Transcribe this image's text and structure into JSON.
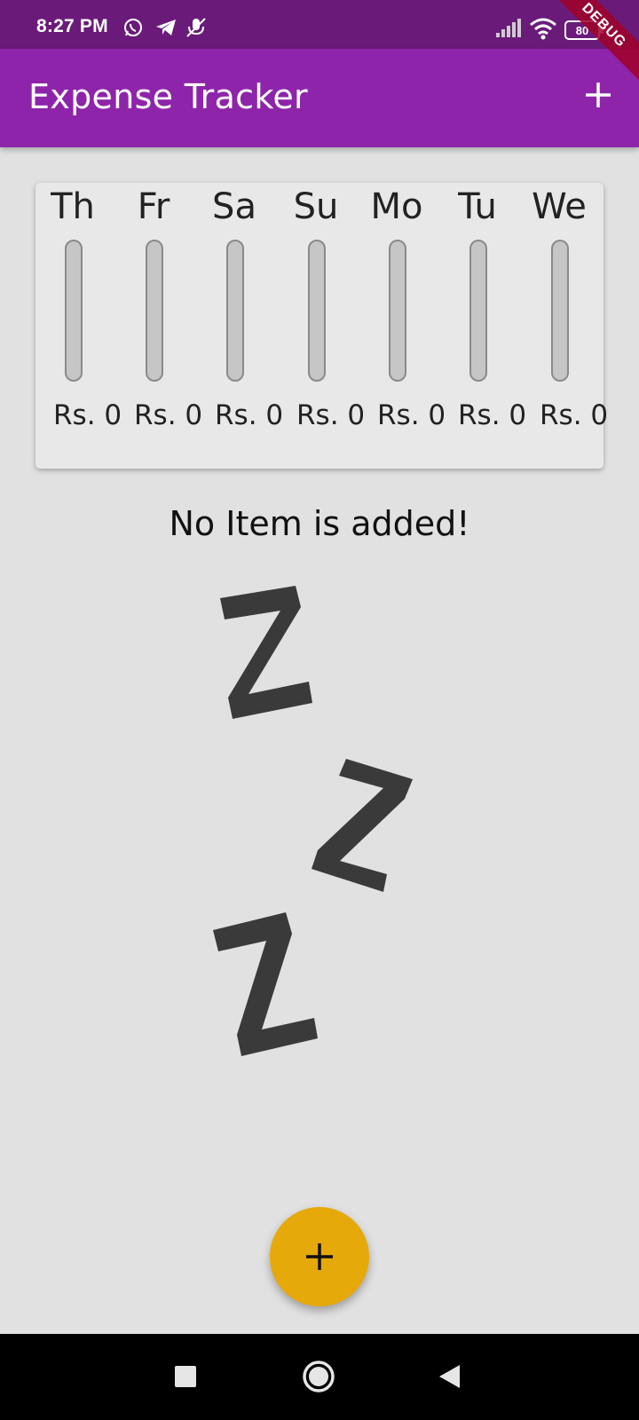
{
  "status_bar": {
    "time": "8:27 PM",
    "battery": "80",
    "icons": [
      "whatsapp-icon",
      "telegram-icon",
      "muted-mic-icon",
      "signal-icon",
      "wifi-icon",
      "battery-icon"
    ]
  },
  "debug_banner": "DEBUG",
  "app_bar": {
    "title": "Expense Tracker",
    "add_icon": "plus-icon"
  },
  "chart": {
    "days": [
      {
        "label": "Th",
        "amount": "Rs. 0",
        "fraction": 0
      },
      {
        "label": "Fr",
        "amount": "Rs. 0",
        "fraction": 0
      },
      {
        "label": "Sa",
        "amount": "Rs. 0",
        "fraction": 0
      },
      {
        "label": "Su",
        "amount": "Rs. 0",
        "fraction": 0
      },
      {
        "label": "Mo",
        "amount": "Rs. 0",
        "fraction": 0
      },
      {
        "label": "Tu",
        "amount": "Rs. 0",
        "fraction": 0
      },
      {
        "label": "We",
        "amount": "Rs. 0",
        "fraction": 0
      }
    ]
  },
  "empty_state": {
    "message": "No Item is added!",
    "image_icon": "sleeping-zzz-icon"
  },
  "fab": {
    "icon": "plus-icon"
  },
  "nav_bar": {
    "icons": [
      "recents-square-icon",
      "home-circle-icon",
      "back-triangle-icon"
    ]
  },
  "colors": {
    "primary": "#8e24aa",
    "status_bar": "#6a1b7a",
    "accent": "#e6a90a",
    "background": "#e1e1e1"
  }
}
